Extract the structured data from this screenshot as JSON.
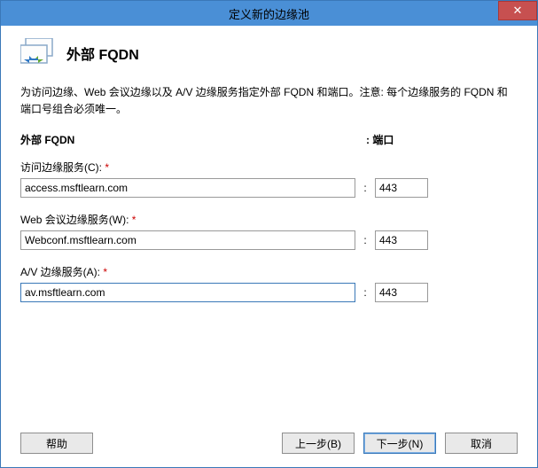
{
  "window": {
    "title": "定义新的边缘池",
    "close_glyph": "✕"
  },
  "page": {
    "heading": "外部 FQDN",
    "description": "为访问边缘、Web 会议边缘以及 A/V 边缘服务指定外部 FQDN 和端口。注意: 每个边缘服务的 FQDN 和端口号组合必须唯一。"
  },
  "columns": {
    "fqdn": "外部 FQDN",
    "port": ": 端口"
  },
  "fields": {
    "access": {
      "label": "访问边缘服务(C):",
      "required": "*",
      "value": "access.msftlearn.com",
      "port": "443"
    },
    "webconf": {
      "label": "Web 会议边缘服务(W):",
      "required": "*",
      "value": "Webconf.msftlearn.com",
      "port": "443"
    },
    "av": {
      "label": "A/V 边缘服务(A):",
      "required": "*",
      "value": "av.msftlearn.com",
      "port": "443"
    },
    "separator": ":"
  },
  "buttons": {
    "help": "帮助",
    "back": "上一步(B)",
    "next": "下一步(N)",
    "cancel": "取消"
  }
}
